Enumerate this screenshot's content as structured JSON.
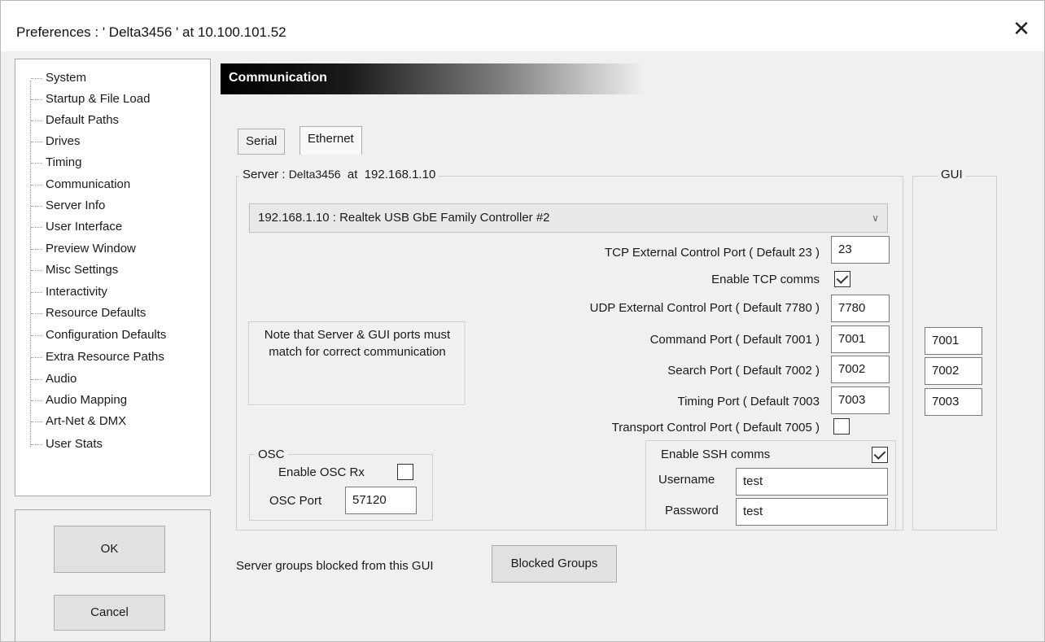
{
  "window": {
    "title": "Preferences  :  ' Delta3456 '  at  10.100.101.52",
    "close_icon": "✕"
  },
  "sidebar": {
    "items": [
      {
        "label": "System"
      },
      {
        "label": "Startup & File Load"
      },
      {
        "label": "Default Paths"
      },
      {
        "label": "Drives"
      },
      {
        "label": "Timing"
      },
      {
        "label": "Communication"
      },
      {
        "label": "Server Info"
      },
      {
        "label": "User Interface"
      },
      {
        "label": "Preview Window"
      },
      {
        "label": "Misc Settings"
      },
      {
        "label": "Interactivity"
      },
      {
        "label": "Resource Defaults"
      },
      {
        "label": "Configuration Defaults"
      },
      {
        "label": "Extra Resource Paths"
      },
      {
        "label": "Audio"
      },
      {
        "label": "Audio Mapping"
      },
      {
        "label": "Art-Net & DMX"
      },
      {
        "label": "User Stats"
      }
    ]
  },
  "buttons": {
    "ok": "OK",
    "cancel": "Cancel"
  },
  "section": {
    "title": "Communication"
  },
  "tabs": {
    "serial": "Serial",
    "ethernet": "Ethernet"
  },
  "server": {
    "legend_prefix": "Server : ",
    "legend_name": "Delta3456",
    "legend_at": "  at  ",
    "legend_ip": "192.168.1.10",
    "adapter": "192.168.1.10 : Realtek USB GbE Family Controller #2",
    "tcp_port_label": "TCP External Control Port ( Default 23 )",
    "tcp_port_value": "23",
    "enable_tcp_label": "Enable TCP comms",
    "enable_tcp_checked": true,
    "udp_port_label": "UDP External Control Port ( Default 7780 )",
    "udp_port_value": "7780",
    "command_port_label": "Command Port ( Default 7001 )",
    "command_port_value": "7001",
    "search_port_label": "Search Port ( Default 7002 )",
    "search_port_value": "7002",
    "timing_port_label": "Timing Port ( Default 7003",
    "timing_port_value": "7003",
    "transport_port_label": "Transport Control Port ( Default 7005 )",
    "transport_checked": false,
    "note": "Note that Server & GUI ports must match for correct communication"
  },
  "osc": {
    "legend": "OSC",
    "enable_label": "Enable OSC Rx",
    "enable_checked": false,
    "port_label": "OSC Port",
    "port_value": "57120"
  },
  "ssh": {
    "enable_label": "Enable SSH comms",
    "enable_checked": true,
    "username_label": "Username",
    "username_value": "test",
    "password_label": "Password",
    "password_value": "test"
  },
  "gui": {
    "legend": "GUI",
    "command_port_value": "7001",
    "search_port_value": "7002",
    "timing_port_value": "7003"
  },
  "blocked": {
    "label": "Server groups blocked from this GUI",
    "button": "Blocked Groups"
  }
}
